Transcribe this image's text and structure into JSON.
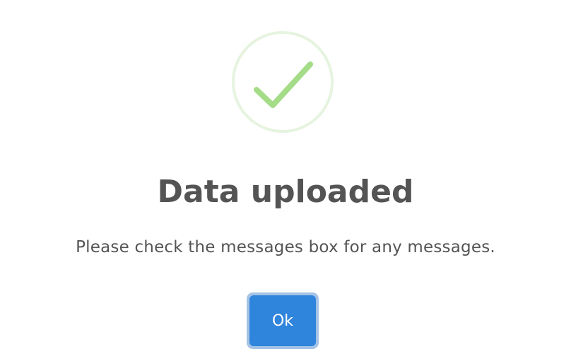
{
  "dialog": {
    "icon": "success-check-icon",
    "title": "Data uploaded",
    "message": "Please check the messages box for any messages.",
    "confirm_label": "Ok"
  },
  "colors": {
    "icon_ring": "#e6f4df",
    "icon_check": "#a4dc88",
    "text": "#545454",
    "button": "#2f84dc",
    "button_focus_ring": "#a4c3e6"
  }
}
